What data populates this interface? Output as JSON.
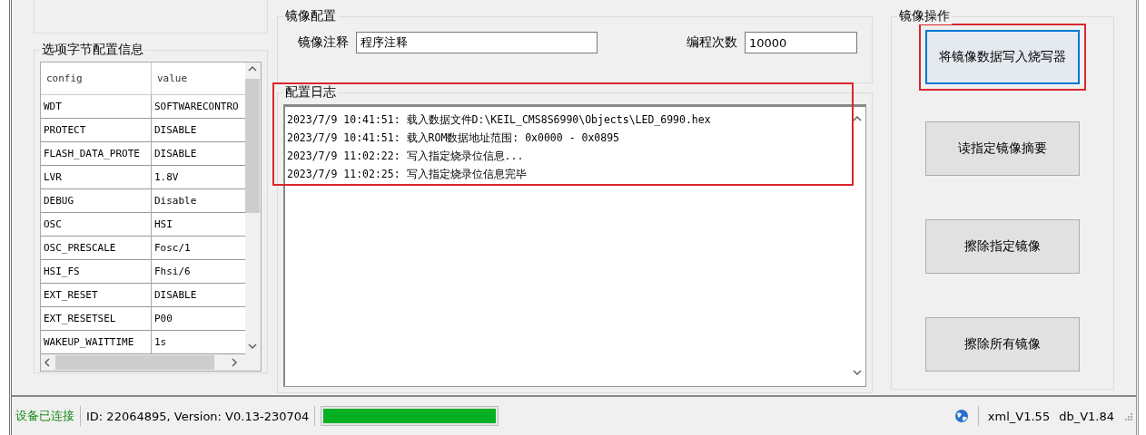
{
  "option_bytes": {
    "title": "选项字节配置信息",
    "columns": [
      "config",
      "value"
    ],
    "rows": [
      [
        "WDT",
        "SOFTWARECONTRO"
      ],
      [
        "PROTECT",
        "DISABLE"
      ],
      [
        "FLASH_DATA_PROTE",
        "DISABLE"
      ],
      [
        "LVR",
        "1.8V"
      ],
      [
        "DEBUG",
        "Disable"
      ],
      [
        "OSC",
        "HSI"
      ],
      [
        "OSC_PRESCALE",
        "Fosc/1"
      ],
      [
        "HSI_FS",
        "Fhsi/6"
      ],
      [
        "EXT_RESET",
        "DISABLE"
      ],
      [
        "EXT_RESETSEL",
        "P00"
      ],
      [
        "WAKEUP_WAITTIME",
        "1s"
      ]
    ]
  },
  "image_config": {
    "title": "镜像配置",
    "comment_label": "镜像注释",
    "comment_value": "程序注释",
    "count_label": "编程次数",
    "count_value": "10000"
  },
  "log": {
    "title": "配置日志",
    "lines": [
      "2023/7/9 10:41:51: 载入数据文件D:\\KEIL_CMS8S6990\\Objects\\LED_6990.hex",
      "2023/7/9 10:41:51: 载入ROM数据地址范围: 0x0000 - 0x0895",
      "2023/7/9 11:02:22: 写入指定烧录位信息...",
      "2023/7/9 11:02:25: 写入指定烧录位信息完毕"
    ]
  },
  "operations": {
    "title": "镜像操作",
    "buttons": [
      {
        "label": "将镜像数据写入烧写器",
        "focused": true
      },
      {
        "label": "读指定镜像摘要",
        "focused": false
      },
      {
        "label": "擦除指定镜像",
        "focused": false
      },
      {
        "label": "擦除所有镜像",
        "focused": false
      }
    ]
  },
  "status_bar": {
    "connection": "设备已连接",
    "device_info": "ID: 22064895, Version: V0.13-230704",
    "progress": {
      "level": 1
    },
    "xml_version": "xml_V1.55",
    "db_version": "db_V1.84"
  }
}
